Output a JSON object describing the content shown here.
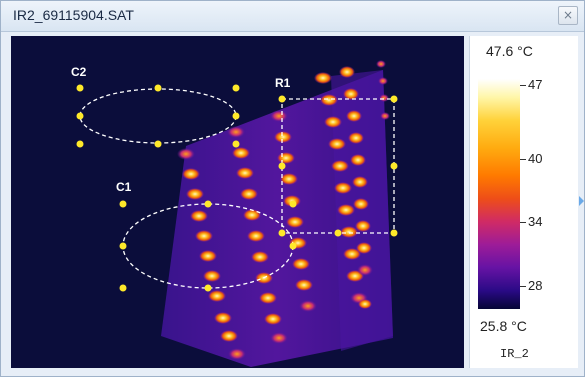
{
  "window": {
    "title": "IR2_69115904.SAT",
    "close_glyph": "×"
  },
  "markers": {
    "c2": "C2",
    "r1": "R1",
    "c1": "C1"
  },
  "scale": {
    "max": "47.6 °C",
    "min": "25.8 °C",
    "name": "IR_2",
    "ticks": [
      {
        "label": "47",
        "value": 47
      },
      {
        "label": "40",
        "value": 40
      },
      {
        "label": "34",
        "value": 34
      },
      {
        "label": "28",
        "value": 28
      }
    ],
    "range": [
      25.8,
      47.6
    ]
  },
  "colors": {
    "marker": "#ffe92a",
    "outline": "#ffffff",
    "background": "#0b0d3b"
  },
  "icons": {
    "close": "close-icon"
  }
}
